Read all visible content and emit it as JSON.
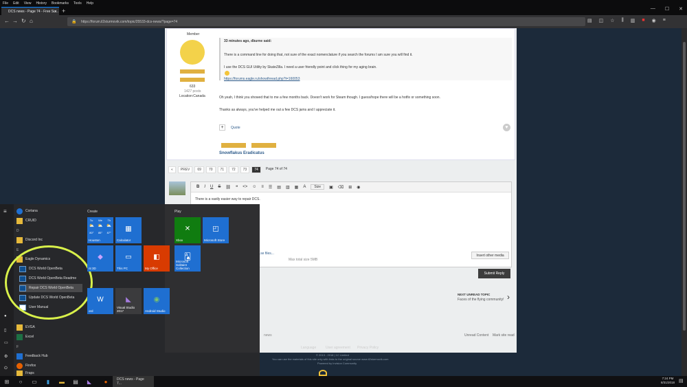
{
  "menu": {
    "items": [
      "File",
      "Edit",
      "View",
      "History",
      "Bookmarks",
      "Tools",
      "Help"
    ]
  },
  "tab": {
    "title": "DCS news - Page 74 - Free Su..."
  },
  "url": "https://forum.il2sturmovik.com/topic/25533-dcs-news/?page=74",
  "post": {
    "member": "Member",
    "points": "633",
    "posts": "1427 posts",
    "location": "Location:Canada",
    "quote_header": "33 minutes ago, dburne said:",
    "quote_line1": "There is a command line for doing that, not sure of the exact nomenclature if you search the forums I am sure you will find it.",
    "quote_line2": "I use the DCS GUI Utility by SkateZilla. I need a user friendly point and click thing for my aging brain.",
    "quote_link": "https://forums.eagle.ru/showthread.php?t=160053",
    "body1": "Oh yeah, I think you showed that to me a few months back. Doesn't work for Steam though. I guess/hope there will be a hotfix or something soon.",
    "body2": "Thanks as always, you've helped me out a few DCS jams and I appreciate it.",
    "quote_btn": "Quote",
    "sig_name": "Snowflakus Eradicatus"
  },
  "pager": {
    "prev": "PREV",
    "pages": [
      "69",
      "70",
      "71",
      "72",
      "73",
      "74"
    ],
    "current": "74",
    "label": "Page 74 of 74"
  },
  "editor": {
    "text": "There is a vastly easier way to repair DCS.",
    "attach_link": "...se files...",
    "attach_info": "Max total size 5MB",
    "insert_media": "Insert other media",
    "submit": "Submit Reply",
    "size_label": "Size"
  },
  "next": {
    "label": "NEXT UNREAD TOPIC",
    "title": "Faces of the flying community!"
  },
  "foot": {
    "language": "Language",
    "agreement": "User agreement",
    "privacy": "Privacy Policy",
    "copy1": "© 2013 - 2018 | 1C Limited",
    "copy2": "You can use the materials of this site only with links to the original source www.il2sturmovik.com",
    "copy3": "Powered by Invision Community",
    "unread": "Unread Content",
    "mark": "Mark site read",
    "news": "news"
  },
  "start": {
    "cortana": "Cortana",
    "cruid": "CRUID",
    "letter_d": "D",
    "discord": "Discord Inc",
    "letter_e": "E",
    "eagle": "Eagle Dynamics",
    "sub": [
      "DCS World OpenBeta",
      "DCS World OpenBeta Readme",
      "Repair DCS World OpenBeta",
      "Update DCS World OpenBeta",
      "User Manual"
    ],
    "evga": "EVGA",
    "excel": "Excel",
    "letter_f": "F",
    "feedback": "Feedback Hub",
    "firefox": "Firefox",
    "fraps": "Fraps",
    "create": "Create",
    "play": "Play",
    "weather": {
      "d1": "Tu",
      "d2": "We",
      "d3": "Th",
      "t1": "80°",
      "t2": "85°",
      "t3": "87°",
      "city": "Houston"
    },
    "tiles": {
      "calculator": "Calculator",
      "paint3d": "nt 3D",
      "thispc": "This PC",
      "myoffice": "My Office",
      "word": "ord",
      "vs": "Visual Studio 2017",
      "android": "Android Studio",
      "xbox": "Xbox",
      "store": "Microsoft Store",
      "solitaire": "Microsoft Solitaire Collection"
    }
  },
  "taskbar": {
    "app": "DCS news - Page 7...",
    "time": "7:24 PM",
    "date": "8/31/2018"
  }
}
